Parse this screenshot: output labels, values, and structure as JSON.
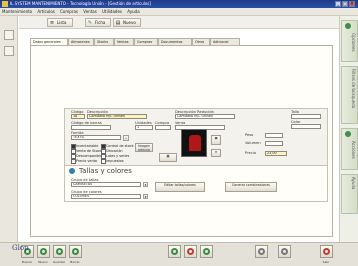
{
  "window": {
    "title": "IL SYSTEM  MANTENIMIENTO - Tecnología Unión - [Gestión de artículos]",
    "min": "_",
    "max": "□",
    "close": "X"
  },
  "menu": [
    "Mantenimiento",
    "Artículos",
    "Compras",
    "Ventas",
    "Utilidades",
    "Ayuda"
  ],
  "toolbar": {
    "list": "Lista",
    "file": "Ficha",
    "new": "Nuevo"
  },
  "tabs": [
    "Datos generales",
    "Almacenes",
    "Stocks",
    "Ventas",
    "Compras",
    "Documentos",
    "Otros",
    "Adicional"
  ],
  "form": {
    "code_label": "Código",
    "code_value": "18",
    "desc_label": "Descripción",
    "desc_value": "Camiseta M/C Unisex",
    "short_desc_label": "Descripción Reducida",
    "short_desc_value": "Camiseta M/C Unisex",
    "barcode_label": "Código de barras",
    "barcode_value": "",
    "family_label": "Familia",
    "family_value": "TEXTIL",
    "units_label": "Unidades",
    "units_value": "1",
    "purchase_label": "Compra",
    "sale_label": "Venta",
    "checks": [
      {
        "label": "Inventariable",
        "on": true
      },
      {
        "label": "Venta de Stock",
        "on": false
      },
      {
        "label": "Descomponible",
        "on": false
      },
      {
        "label": "Control de stock",
        "on": true
      },
      {
        "label": "Ubicación",
        "on": false
      },
      {
        "label": "Lotes y series",
        "on": false
      },
      {
        "label": "Precio venta",
        "on": false
      },
      {
        "label": "Impuestos",
        "on": false
      }
    ],
    "image_label": "Imagen artículo",
    "weight_label": "Peso",
    "volume_label": "Volumen",
    "price_label": "Precio",
    "price_value": "23,00",
    "size_label": "Talla",
    "size_value": "",
    "color_label": "Color",
    "color_value": ""
  },
  "colors_section": {
    "title": "Tallas y colores",
    "size_group_label": "Grupo de tallas",
    "size_group_value": "CAMISETAS",
    "color_group_label": "Grupo de colores",
    "color_group_value": "COLORES",
    "btn1": "Editar tallas/colores",
    "btn2": "Generar combinaciones"
  },
  "side": {
    "tabs": [
      "Opciones",
      "Filtros de búsqueda",
      "Acciones",
      "Ayuda"
    ]
  },
  "brand": "Glop",
  "bottom": {
    "buttons": [
      "Buscar",
      "Nuevo",
      "Guardar",
      "Borrar",
      "",
      "",
      "",
      "",
      "",
      "Salir"
    ]
  }
}
